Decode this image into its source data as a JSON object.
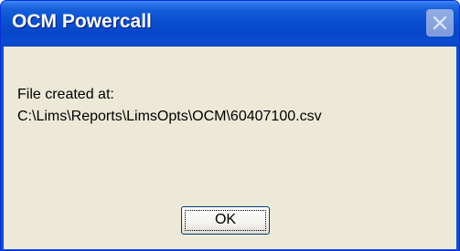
{
  "window": {
    "title": "OCM Powercall",
    "close_icon": "close-icon"
  },
  "message": {
    "line1": "File created at:",
    "line2": "C:\\Lims\\Reports\\LimsOpts\\OCM\\60407100.csv"
  },
  "buttons": {
    "ok_label": "OK"
  },
  "colors": {
    "titlebar": "#0a4fd2",
    "client_background": "#ece9d8",
    "close_button": "#94aadf"
  }
}
